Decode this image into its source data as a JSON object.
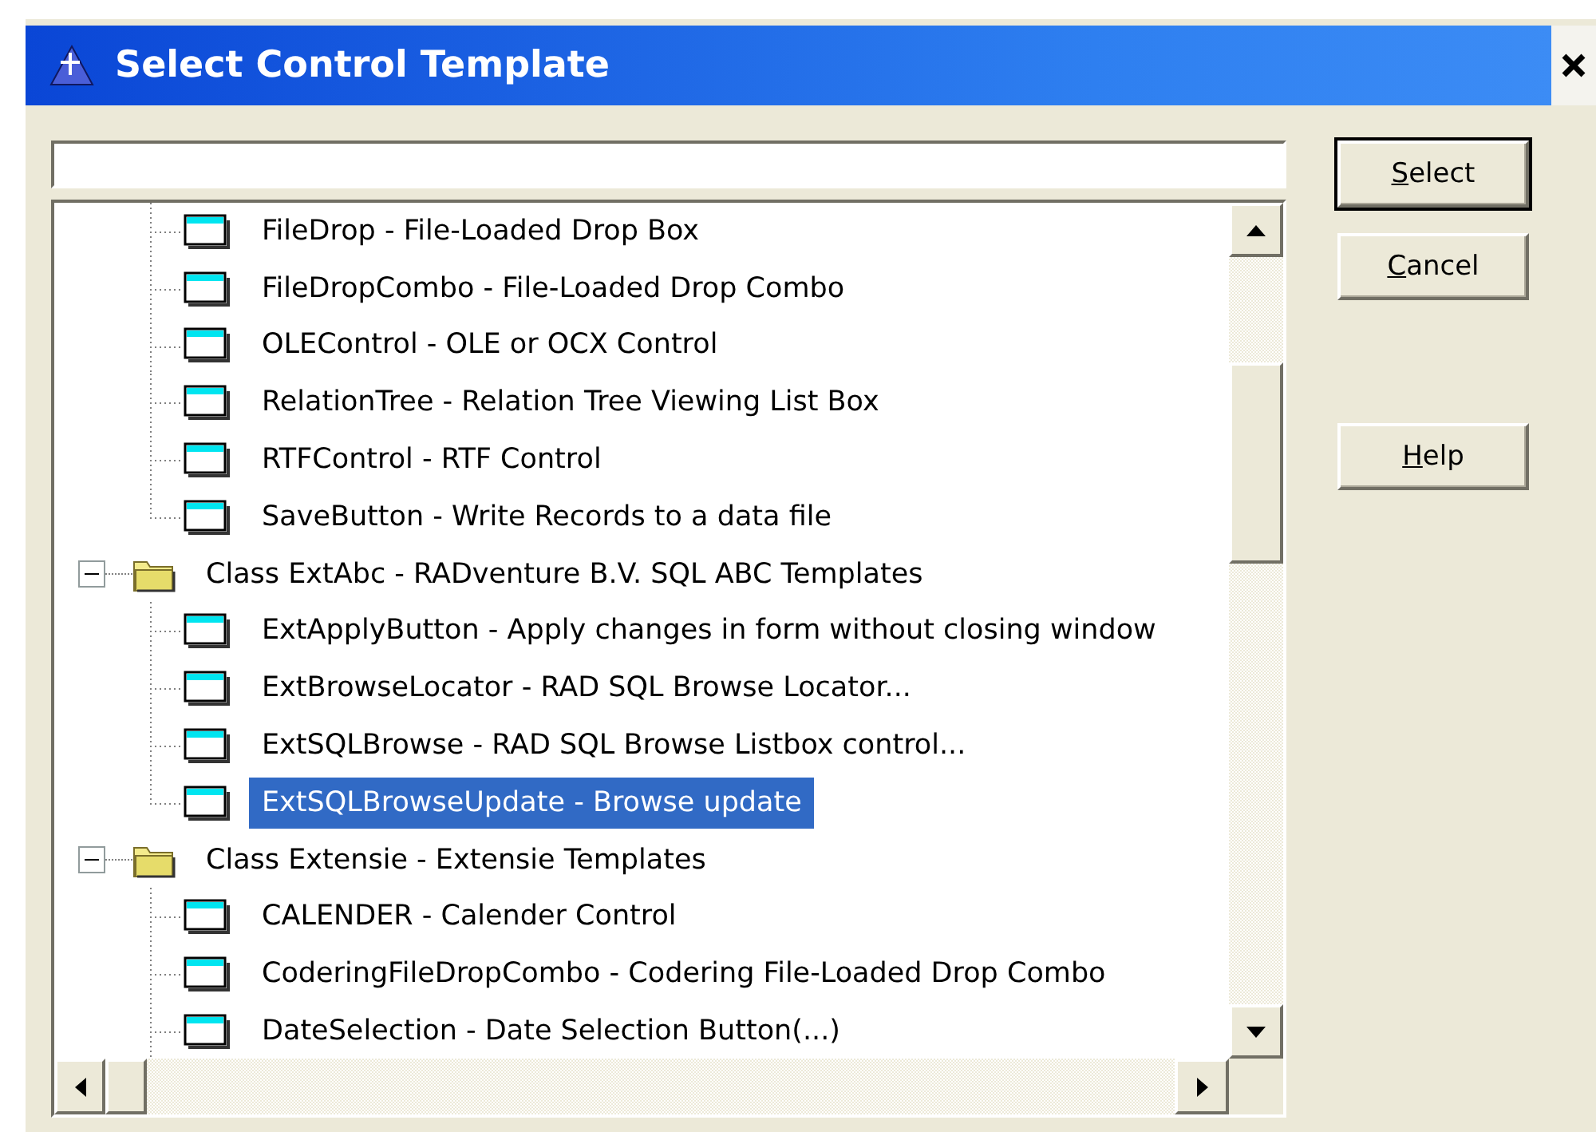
{
  "window": {
    "title": "Select Control Template"
  },
  "tree": [
    {
      "children": [
        {
          "label": "FileDrop - File-Loaded Drop Box",
          "selected": false
        },
        {
          "label": "FileDropCombo - File-Loaded Drop Combo",
          "selected": false
        },
        {
          "label": "OLEControl - OLE or OCX Control",
          "selected": false
        },
        {
          "label": "RelationTree - Relation Tree Viewing List Box",
          "selected": false
        },
        {
          "label": "RTFControl - RTF Control",
          "selected": false
        },
        {
          "label": "SaveButton - Write Records to a data file",
          "selected": false
        }
      ]
    },
    {
      "label": "Class ExtAbc - RADventure B.V. SQL ABC Templates",
      "expanded": true,
      "children": [
        {
          "label": "ExtApplyButton - Apply changes in form without closing window",
          "selected": false
        },
        {
          "label": "ExtBrowseLocator - RAD SQL Browse Locator...",
          "selected": false
        },
        {
          "label": "ExtSQLBrowse - RAD SQL Browse Listbox control...",
          "selected": false
        },
        {
          "label": "ExtSQLBrowseUpdate - Browse update",
          "selected": true
        }
      ]
    },
    {
      "label": "Class Extensie - Extensie Templates",
      "expanded": true,
      "children": [
        {
          "label": "CALENDER - Calender Control",
          "selected": false
        },
        {
          "label": "CoderingFileDropCombo - Codering File-Loaded Drop Combo",
          "selected": false
        },
        {
          "label": "DateSelection - Date Selection Button(...)",
          "selected": false
        }
      ]
    }
  ],
  "buttons": [
    {
      "label": "Select",
      "default": true,
      "mnemonic": true,
      "kind": "top"
    },
    {
      "label": "Cancel",
      "default": false,
      "mnemonic": true,
      "kind": "top"
    },
    {
      "label": "Help",
      "default": false,
      "mnemonic": true,
      "kind": "bottom"
    }
  ]
}
